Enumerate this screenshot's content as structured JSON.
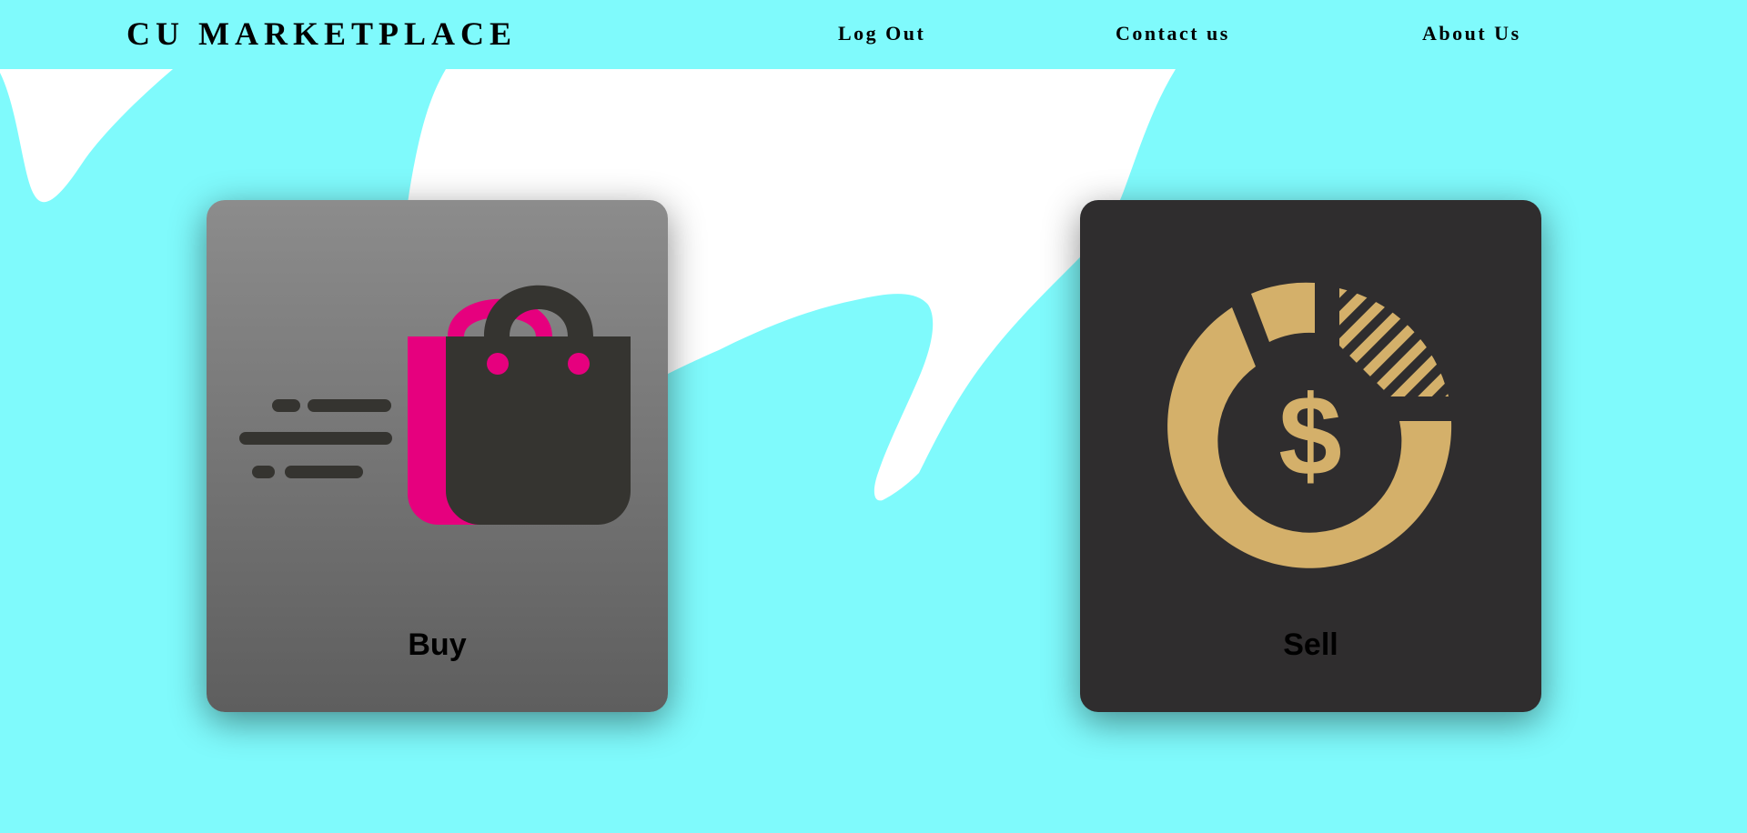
{
  "colors": {
    "background": "#7ffafc",
    "wave": "#ffffff",
    "buy_card_top": "#8c8c8c",
    "buy_card_bottom": "#5e5e5e",
    "sell_card": "#2f2d2e",
    "bag_pink": "#e6007e",
    "bag_dark": "#353430",
    "gold": "#d4b06a"
  },
  "navbar": {
    "brand": "CU MARKETPLACE",
    "links": [
      {
        "label": "Log Out"
      },
      {
        "label": "Contact us"
      },
      {
        "label": "About Us"
      }
    ]
  },
  "cards": [
    {
      "label": "Buy",
      "icon": "shopping-bag-icon"
    },
    {
      "label": "Sell",
      "icon": "dollar-pie-chart-icon"
    }
  ]
}
